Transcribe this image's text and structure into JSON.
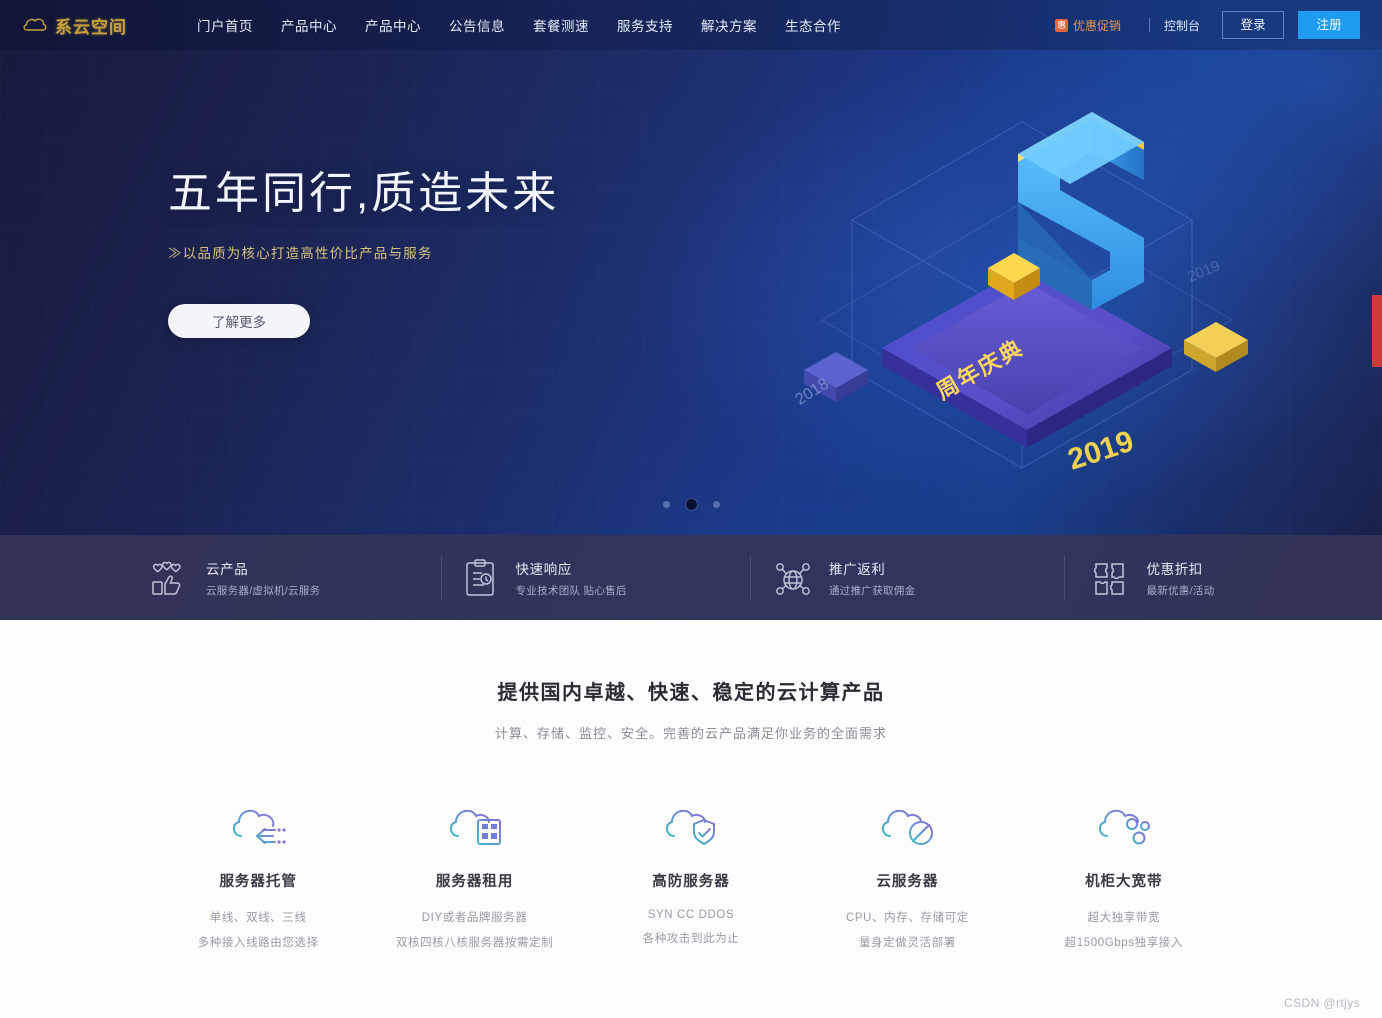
{
  "nav": {
    "logo_text": "系云空间",
    "logo_icon": "cloud-icon",
    "links": [
      {
        "label": "门户首页"
      },
      {
        "label": "产品中心"
      },
      {
        "label": "产品中心"
      },
      {
        "label": "公告信息"
      },
      {
        "label": "套餐测速"
      },
      {
        "label": "服务支持"
      },
      {
        "label": "解决方案"
      },
      {
        "label": "生态合作"
      }
    ],
    "promo_badge": "惠",
    "promo_label": "优惠促销",
    "console_label": "控制台",
    "login_label": "登录",
    "register_label": "注册",
    "accent_color": "#1f9bf0",
    "promo_color": "#e8944a",
    "logo_color": "#c9a13a"
  },
  "hero": {
    "title": "五年同行,质造未来",
    "subtitle": "≫以品质为核心打造高性价比产品与服务",
    "cta_label": "了解更多",
    "art_year_left": "2018",
    "art_year_right": "2019",
    "art_badge": "周年庆典",
    "carousel": {
      "total": 3,
      "active_index": 1
    }
  },
  "feature_bar": {
    "items": [
      {
        "icon": "cloud-like-icon",
        "title": "云产品",
        "desc": "云服务器/虚拟机/云服务"
      },
      {
        "icon": "clipboard-icon",
        "title": "快速响应",
        "desc": "专业技术团队 贴心售后"
      },
      {
        "icon": "globe-network-icon",
        "title": "推广返利",
        "desc": "通过推广获取佣金"
      },
      {
        "icon": "puzzle-icon",
        "title": "优惠折扣",
        "desc": "最新优惠/活动"
      }
    ]
  },
  "main": {
    "section_title": "提供国内卓越、快速、稳定的云计算产品",
    "section_subtitle": "计算、存储、监控、安全。完善的云产品满足你业务的全面需求",
    "products": [
      {
        "icon": "cloud-host-icon",
        "name": "服务器托管",
        "line1": "单线、双线、三线",
        "line2": "多种接入线路由您选择"
      },
      {
        "icon": "cloud-rent-icon",
        "name": "服务器租用",
        "line1": "DIY或者品牌服务器",
        "line2": "双核四核八核服务器按需定制"
      },
      {
        "icon": "cloud-shield-icon",
        "name": "高防服务器",
        "line1": "SYN CC DDOS",
        "line2": "各种攻击到此为止"
      },
      {
        "icon": "cloud-server-icon",
        "name": "云服务器",
        "line1": "CPU、内存、存储可定",
        "line2": "量身定做灵活部署"
      },
      {
        "icon": "cloud-bandwidth-icon",
        "name": "机柜大宽带",
        "line1": "超大独享带宽",
        "line2": "超1500Gbps独享接入"
      }
    ]
  },
  "watermark": "CSDN @rtjys"
}
